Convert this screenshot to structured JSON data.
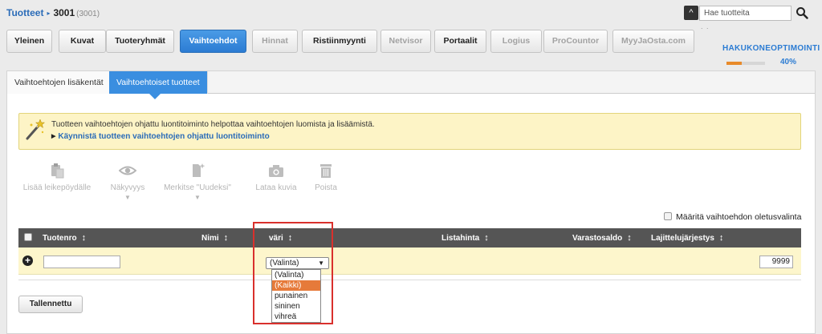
{
  "breadcrumb": {
    "parent": "Tuotteet",
    "current": "3001",
    "sub": "(3001)"
  },
  "search": {
    "placeholder": "Hae tuotteita"
  },
  "tabs": [
    {
      "label": "Yleinen"
    },
    {
      "label": "Kuvat"
    },
    {
      "label": "Tuoteryhmät"
    },
    {
      "label": "Vaihtoehdot"
    },
    {
      "label": "Hinnat"
    },
    {
      "label": "Ristiinmyynti"
    },
    {
      "label": "Netvisor"
    },
    {
      "label": "Portaalit"
    },
    {
      "label": "Logius"
    },
    {
      "label": "ProCountor"
    },
    {
      "label": "MyyJaOsta.com"
    }
  ],
  "active_tab": "Vaihtoehdot",
  "seo": {
    "title": "HAKUKONEOPTIMOINTI",
    "percent_label": "40%",
    "progress": 0.4,
    "progress_color": "#e88a2a"
  },
  "subtabs": [
    {
      "label": "Vaihtoehtojen lisäkentät"
    },
    {
      "label": "Vaihtoehtoiset tuotteet"
    }
  ],
  "notice": {
    "text": "Tuotteen vaihtoehtojen ohjattu luontitoiminto helpottaa vaihtoehtojen luomista ja lisäämistä.",
    "link": "Käynnistä tuotteen vaihtoehtojen ohjattu luontitoiminto"
  },
  "actions": [
    {
      "label": "Lisää leikepöydälle",
      "icon": "clipboard-icon"
    },
    {
      "label": "Näkyvyys",
      "icon": "eye-icon"
    },
    {
      "label": "Merkitse \"Uudeksi\"",
      "icon": "new-document-icon"
    },
    {
      "label": "Lataa kuvia",
      "icon": "camera-icon"
    },
    {
      "label": "Poista",
      "icon": "trash-icon"
    }
  ],
  "default_option_label": "Määritä vaihtoehdon oletusvalinta",
  "table": {
    "columns": [
      "Tuotenro",
      "Nimi",
      "väri",
      "Listahinta",
      "Varastosaldo",
      "Lajittelujärjestys"
    ],
    "new_row": {
      "tuotenro": "",
      "vari_selected": "(Valinta)",
      "lajittelujarjestys": "9999"
    }
  },
  "dropdown_options": [
    "(Valinta)",
    "(Kaikki)",
    "punainen",
    "sininen",
    "vihreä"
  ],
  "dropdown_highlighted": "(Kaikki)",
  "save_label": "Tallennettu",
  "colors": {
    "accent": "#2c7cd3",
    "highlight_border": "#d9302c",
    "notice_bg": "#fdf4c6",
    "header_bg": "#555555"
  }
}
